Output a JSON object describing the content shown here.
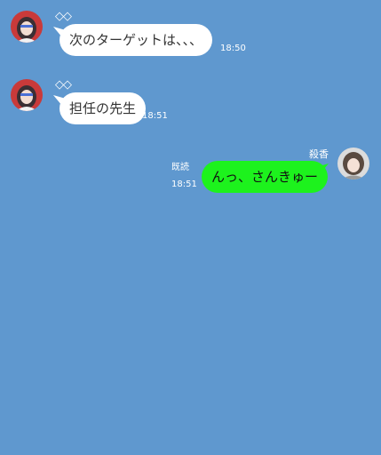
{
  "theme": {
    "background": "#5f98cf",
    "incoming_bubble": "#ffffff",
    "outgoing_bubble": "#1df21d"
  },
  "messages": [
    {
      "direction": "incoming",
      "sender": "◇◇",
      "avatar": "sender-avatar-icon",
      "text": "次のターゲットは、、、",
      "time": "18:50"
    },
    {
      "direction": "incoming",
      "sender": "◇◇",
      "avatar": "sender-avatar-icon",
      "text": "担任の先生",
      "time": "18:51"
    },
    {
      "direction": "outgoing",
      "sender": "殺香",
      "avatar": "user-avatar-icon",
      "text": "んっ、さんきゅー",
      "read_label": "既読",
      "time": "18:51"
    }
  ]
}
